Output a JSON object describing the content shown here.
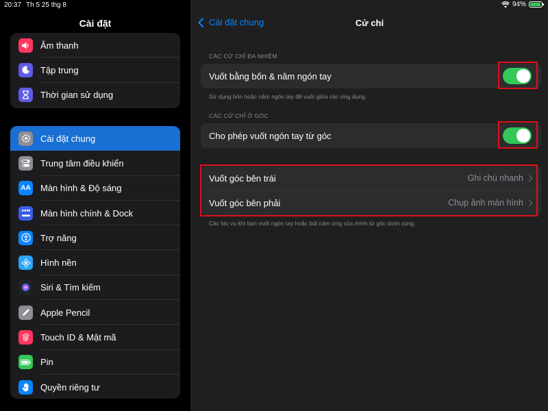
{
  "status_bar": {
    "time": "20:37",
    "date": "Th 5 25 thg 8",
    "battery": "94%"
  },
  "sidebar": {
    "title": "Cài đặt",
    "group1": [
      {
        "label": "Âm thanh",
        "icon": "speaker-icon",
        "color": "#ff375f"
      },
      {
        "label": "Tập trung",
        "icon": "moon-icon",
        "color": "#5e5ce6"
      },
      {
        "label": "Thời gian sử dụng",
        "icon": "hourglass-icon",
        "color": "#5e5ce6"
      }
    ],
    "group2": [
      {
        "label": "Cài đặt chung",
        "icon": "gear-icon",
        "color": "#8e8e93",
        "active": true
      },
      {
        "label": "Trung tâm điều khiển",
        "icon": "toggles-icon",
        "color": "#8e8e93"
      },
      {
        "label": "Màn hình & Độ sáng",
        "icon": "text-size-icon",
        "color": "#0a84ff"
      },
      {
        "label": "Màn hình chính & Dock",
        "icon": "grid-icon",
        "color": "#3c5ce8"
      },
      {
        "label": "Trợ năng",
        "icon": "accessibility-icon",
        "color": "#0a84ff"
      },
      {
        "label": "Hình nền",
        "icon": "flower-icon",
        "color": "#2aa4f4"
      },
      {
        "label": "Siri & Tìm kiếm",
        "icon": "siri-icon",
        "color": "#222222"
      },
      {
        "label": "Apple Pencil",
        "icon": "pencil-icon",
        "color": "#8e8e93"
      },
      {
        "label": "Touch ID & Mật mã",
        "icon": "fingerprint-icon",
        "color": "#ff375f"
      },
      {
        "label": "Pin",
        "icon": "battery-icon",
        "color": "#34c759"
      },
      {
        "label": "Quyền riêng tư",
        "icon": "hand-icon",
        "color": "#0a84ff"
      }
    ]
  },
  "main": {
    "back_label": "Cài đặt chung",
    "title": "Cử chỉ",
    "multitask_header": "CÁC CỬ CHỈ ĐA NHIỆM",
    "four_five_label": "Vuốt bằng bốn & năm ngón tay",
    "four_five_on": true,
    "four_five_footer": "Sử dụng bốn hoặc năm ngón tay để vuốt giữa các ứng dụng.",
    "corner_header": "CÁC CỬ CHỈ Ở GÓC",
    "corner_label": "Cho phép vuốt ngón tay từ góc",
    "corner_on": true,
    "left_corner_label": "Vuốt góc bên trái",
    "left_corner_value": "Ghi chú nhanh",
    "right_corner_label": "Vuốt góc bên phải",
    "right_corner_value": "Chụp ảnh màn hình",
    "corner_footer": "Các tác vụ khi bạn vuốt ngón tay hoặc bút cảm ứng của mình từ góc dưới cùng."
  },
  "colors": {
    "accent": "#0a84ff",
    "toggle_on": "#34c759",
    "highlight": "#e0101a",
    "active_row": "#1a6fd4"
  }
}
